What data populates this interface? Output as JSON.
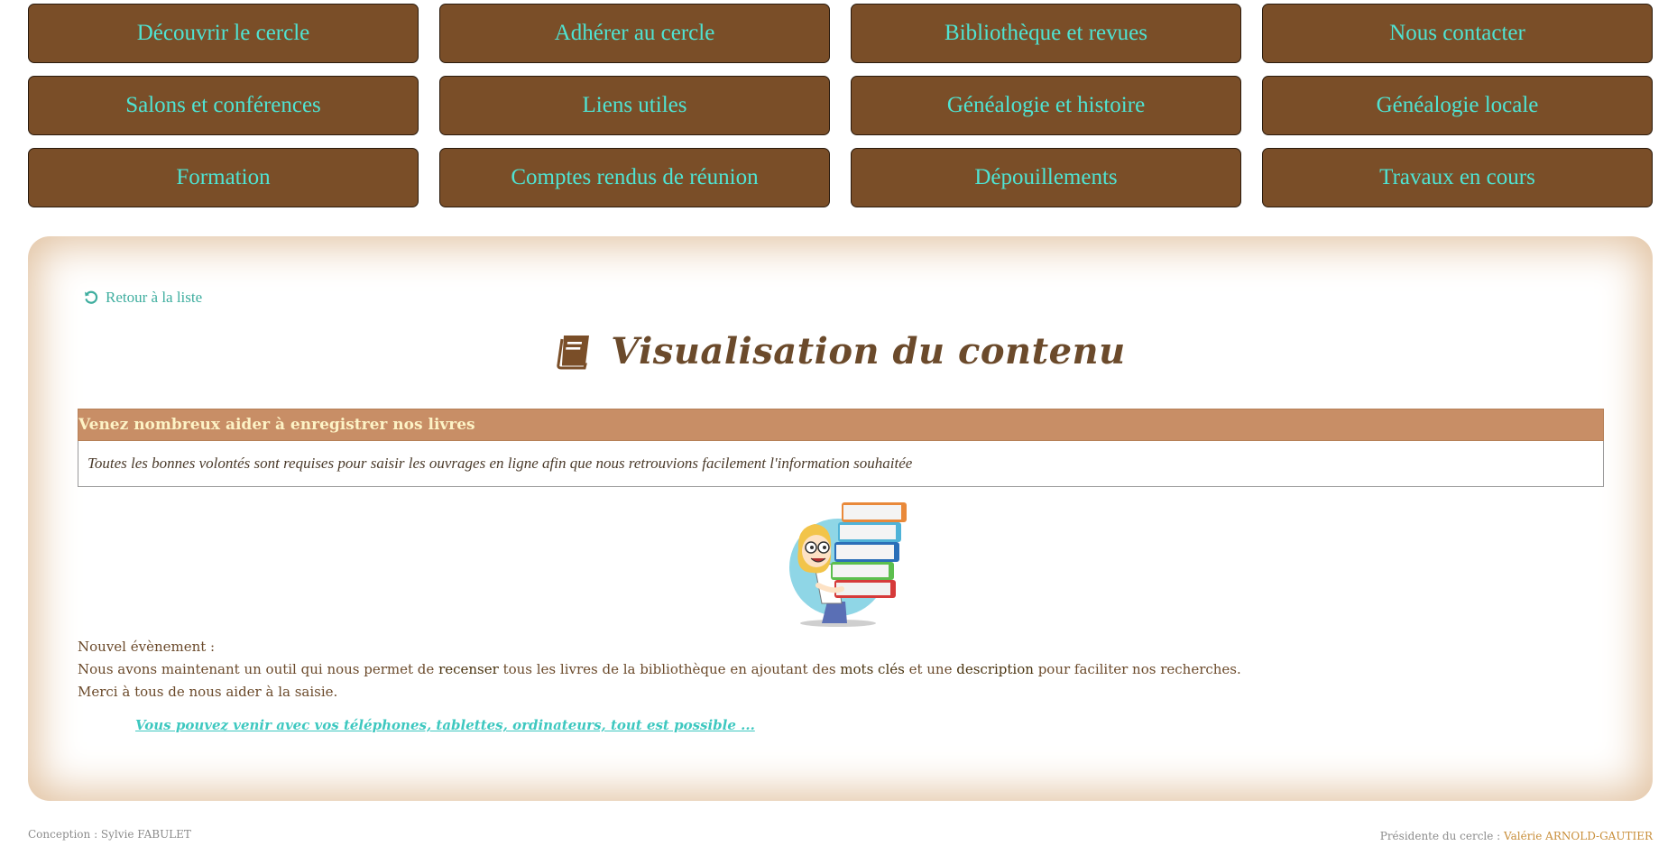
{
  "nav": {
    "items": [
      "Découvrir le cercle",
      "Adhérer au cercle",
      "Bibliothèque et revues",
      "Nous contacter",
      "Salons et conférences",
      "Liens utiles",
      "Généalogie et histoire",
      "Généalogie locale",
      "Formation",
      "Comptes rendus de réunion",
      "Dépouillements",
      "Travaux en cours"
    ]
  },
  "content": {
    "back_label": "Retour à la liste",
    "back_icon": "undo-icon",
    "title_icon": "book-icon",
    "title": "Visualisation du contenu",
    "article": {
      "heading": "Venez nombreux aider à enregistrer nos livres",
      "summary": "Toutes les bonnes volontés sont requises pour saisir les ouvrages en ligne afin que nous retrouvions facilement l'information souhaitée"
    },
    "body": {
      "line1": "Nouvel évènement :",
      "line2_a": "Nous avons maintenant un outil qui nous permet de ",
      "line2_b": "recenser",
      "line2_c": " tous les livres de la bibliothèque en ajoutant des ",
      "line2_d": "mots clés",
      "line2_e": " et une ",
      "line2_f": "description",
      "line2_g": " pour faciliter nos recherches.",
      "line3": "Merci à tous de nous aider à la saisie."
    },
    "cta": "Vous pouvez venir avec vos téléphones, tablettes, ordinateurs, tout est possible ..."
  },
  "footer": {
    "left": "Conception : Sylvie FABULET",
    "right_label": "Présidente du cercle : ",
    "right_name": "Valérie ARNOLD-GAUTIER"
  },
  "colors": {
    "nav_bg": "#7a4e28",
    "nav_text": "#4fe3d2",
    "header_bar": "#c88e66",
    "link": "#3ec8c0"
  }
}
